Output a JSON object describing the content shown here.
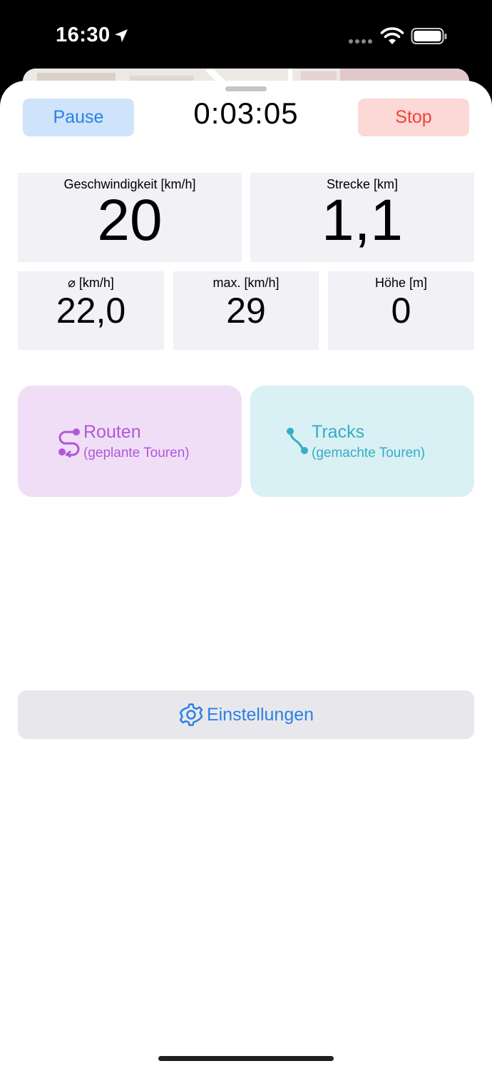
{
  "status_bar": {
    "time": "16:30"
  },
  "controls": {
    "pause_label": "Pause",
    "elapsed": "0:03:05",
    "stop_label": "Stop"
  },
  "stats": {
    "speed": {
      "label": "Geschwindigkeit [km/h]",
      "value": "20"
    },
    "distance": {
      "label": "Strecke [km]",
      "value": "1,1"
    },
    "avg": {
      "label": "⌀ [km/h]",
      "value": "22,0"
    },
    "max": {
      "label": "max. [km/h]",
      "value": "29"
    },
    "altitude": {
      "label": "Höhe [m]",
      "value": "0"
    }
  },
  "cards": {
    "routes": {
      "title": "Routen",
      "subtitle": "(geplante Touren)",
      "icon": "route-icon",
      "color": "#b157d9"
    },
    "tracks": {
      "title": "Tracks",
      "subtitle": "(gemachte Touren)",
      "icon": "track-icon",
      "color": "#35adc6"
    }
  },
  "settings": {
    "label": "Einstellungen",
    "icon": "gear-icon"
  },
  "colors": {
    "accent": "#2b80e8",
    "stop": "#ee4336"
  }
}
